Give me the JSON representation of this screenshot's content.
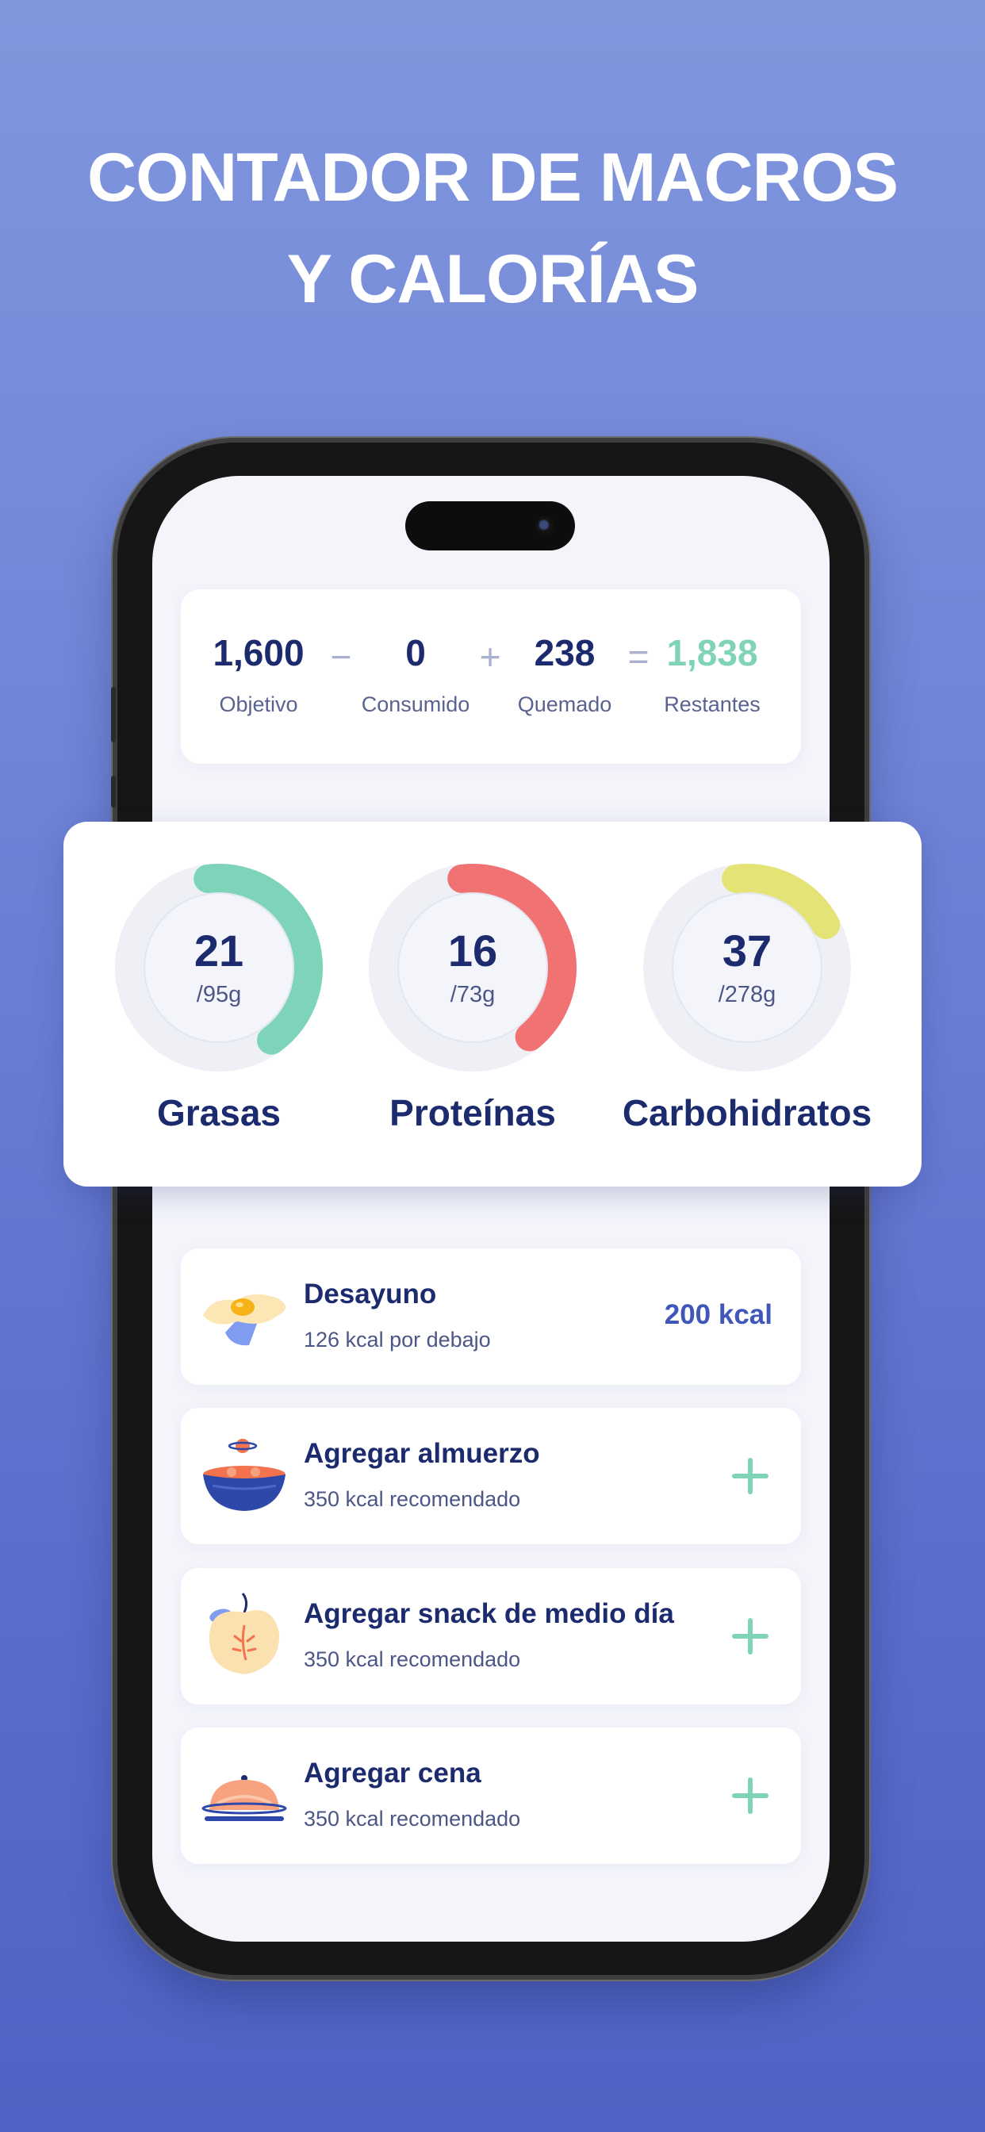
{
  "headline": {
    "line1": "CONTADOR DE MACROS",
    "line2": "Y CALORÍAS"
  },
  "summary": {
    "items": [
      {
        "value": "1,600",
        "label": "Objetivo"
      },
      {
        "value": "0",
        "label": "Consumido"
      },
      {
        "value": "238",
        "label": "Quemado"
      },
      {
        "value": "1,838",
        "label": "Restantes"
      }
    ],
    "operators": [
      "−",
      "+",
      "="
    ],
    "remaining_color": "#7fd3b6"
  },
  "macros": [
    {
      "label": "Grasas",
      "value": "21",
      "target": "/95g",
      "progress_fraction": 0.42,
      "color": "#7ed4bb"
    },
    {
      "label": "Proteínas",
      "value": "16",
      "target": "/73g",
      "progress_fraction": 0.41,
      "color": "#f07272"
    },
    {
      "label": "Carbohidratos",
      "value": "37",
      "target": "/278g",
      "progress_fraction": 0.19,
      "color": "#e3e475"
    }
  ],
  "meals": [
    {
      "title": "Desayuno",
      "subtitle": "126 kcal por debajo",
      "kcal": "200 kcal",
      "icon": "fried-egg-icon"
    },
    {
      "title": "Agregar almuerzo",
      "subtitle": "350 kcal recomendado",
      "icon": "bowl-icon",
      "action": "plus-icon"
    },
    {
      "title": "Agregar snack de medio día",
      "subtitle": "350 kcal recomendado",
      "icon": "apple-icon",
      "action": "plus-icon"
    },
    {
      "title": "Agregar cena",
      "subtitle": "350 kcal recomendado",
      "icon": "cloche-icon",
      "action": "plus-icon"
    }
  ],
  "colors": {
    "accent": "#7fd3b6",
    "navy": "#1c2a6e",
    "blue": "#4056b8"
  }
}
